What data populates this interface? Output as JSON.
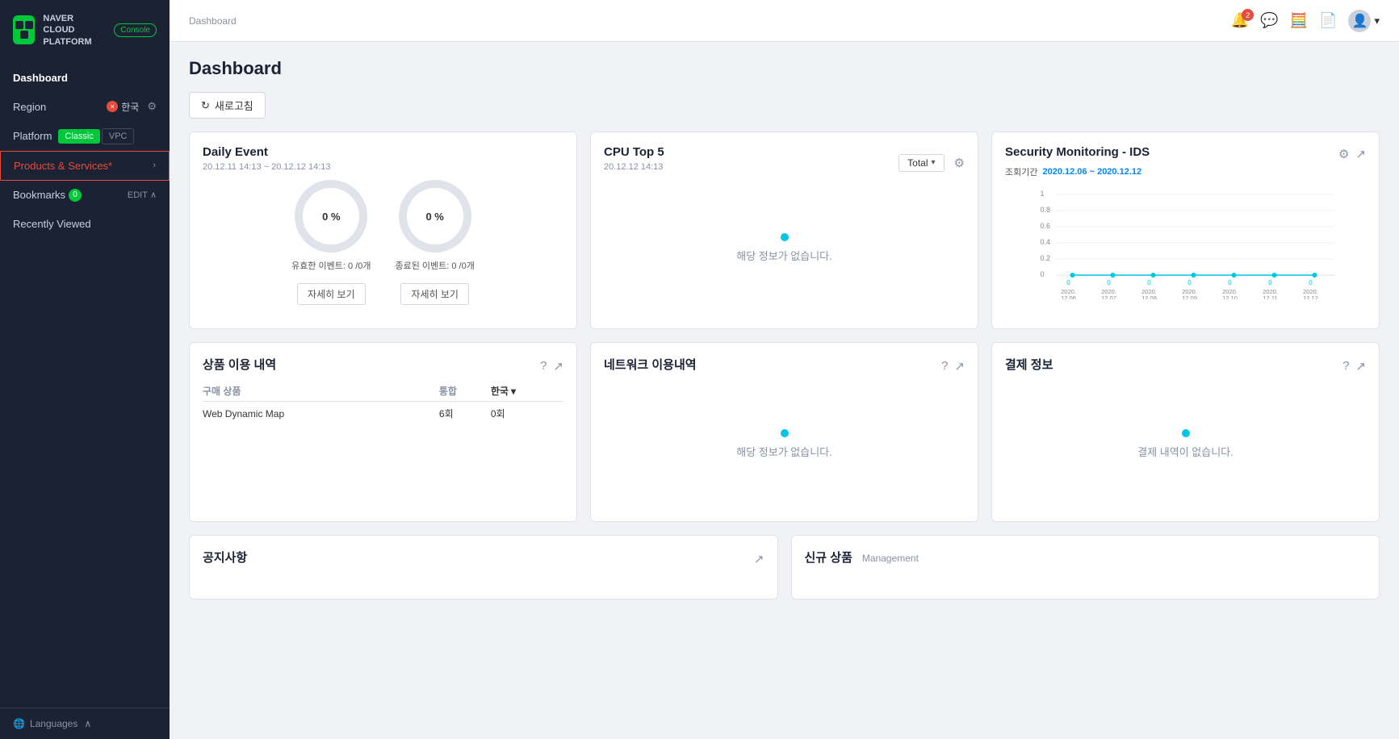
{
  "sidebar": {
    "logo_line1": "NAVER",
    "logo_line2": "CLOUD PLATFORM",
    "console_label": "Console",
    "nav": {
      "dashboard": "Dashboard",
      "region_label": "Region",
      "region_value": "한국",
      "platform_label": "Platform",
      "platform_classic": "Classic",
      "platform_vpc": "VPC",
      "products_label": "Products & Services",
      "products_asterisk": "*",
      "bookmarks_label": "Bookmarks",
      "bookmarks_count": "0",
      "edit_label": "EDIT",
      "recently_viewed": "Recently Viewed"
    },
    "footer_language": "Languages"
  },
  "topbar": {
    "breadcrumb": "Dashboard",
    "notif_count": "2"
  },
  "main": {
    "page_title": "Dashboard",
    "refresh_label": "새로고침",
    "daily_event": {
      "title": "Daily Event",
      "date_range": "20.12.11 14:13 ~ 20.12.12 14:13",
      "donut1_value": "0 %",
      "donut2_value": "0 %",
      "event1_label": "유효한 이벤트: 0 /0개",
      "event2_label": "종료된 이벤트: 0 /0개",
      "detail_btn1": "자세히 보기",
      "detail_btn2": "자세히 보기"
    },
    "cpu_top5": {
      "title": "CPU Top 5",
      "date": "20.12.12 14:13",
      "total_label": "Total",
      "no_data": "해당 정보가 없습니다."
    },
    "security": {
      "title": "Security Monitoring - IDS",
      "period_label": "조회기간",
      "date_range": "2020.12.06 ~ 2020.12.12",
      "y_axis": [
        "1",
        "0.8",
        "0.6",
        "0.4",
        "0.2",
        "0"
      ],
      "x_axis": [
        "2020.\n12.06",
        "2020.\n12.07",
        "2020.\n12.08",
        "2020.\n12.09",
        "2020.\n12.10",
        "2020.\n12.11",
        "2020.\n12.12"
      ],
      "data_values": [
        "0",
        "0",
        "0",
        "0",
        "0",
        "0",
        "0"
      ]
    },
    "usage": {
      "title": "상품 이용 내역",
      "col1": "구매 상품",
      "col2": "통합",
      "col3": "한국",
      "row1_product": "Web Dynamic Map",
      "row1_total": "6회",
      "row1_region": "0회"
    },
    "network": {
      "title": "네트워크 이용내역",
      "no_data": "해당 정보가 없습니다."
    },
    "payment": {
      "title": "결제 정보",
      "no_data": "결제 내역이 없습니다."
    },
    "notice": {
      "title": "공지사항"
    },
    "new_product": {
      "title": "신규 상품",
      "subtitle": "Management"
    }
  }
}
